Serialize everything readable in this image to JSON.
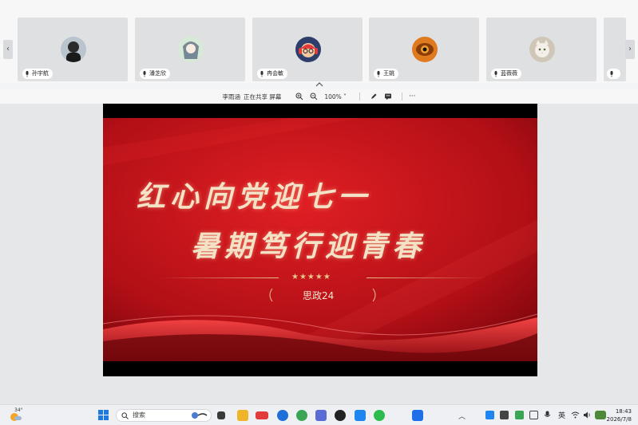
{
  "participants": [
    {
      "name": "孙宇航",
      "avatar": "person-dark-avatar"
    },
    {
      "name": "潘芝欣",
      "avatar": "anime-girl-avatar"
    },
    {
      "name": "冉会敏",
      "avatar": "cartoon-headphones-avatar"
    },
    {
      "name": "王姚",
      "avatar": "eye-closeup-avatar"
    },
    {
      "name": "蓝薇薇",
      "avatar": "cat-avatar"
    },
    {
      "name": "",
      "avatar": ""
    }
  ],
  "share_bar": {
    "sharer": "李雨涵",
    "status": "正在共享 屏幕",
    "zoom": "100%"
  },
  "slide": {
    "title_line1": "红心向党迎七一",
    "title_line2": "暑期笃行迎青春",
    "stars": "★★★★★",
    "subtitle": "思政24"
  },
  "taskbar": {
    "temperature": "34°",
    "search_placeholder": "搜索",
    "ime": "英",
    "time": "18:43",
    "date": "2026/7/8"
  },
  "colors": {
    "slide_red": "#c9141b",
    "accent_gold": "#e8c58a",
    "tile_bg": "#dfe0e2"
  }
}
